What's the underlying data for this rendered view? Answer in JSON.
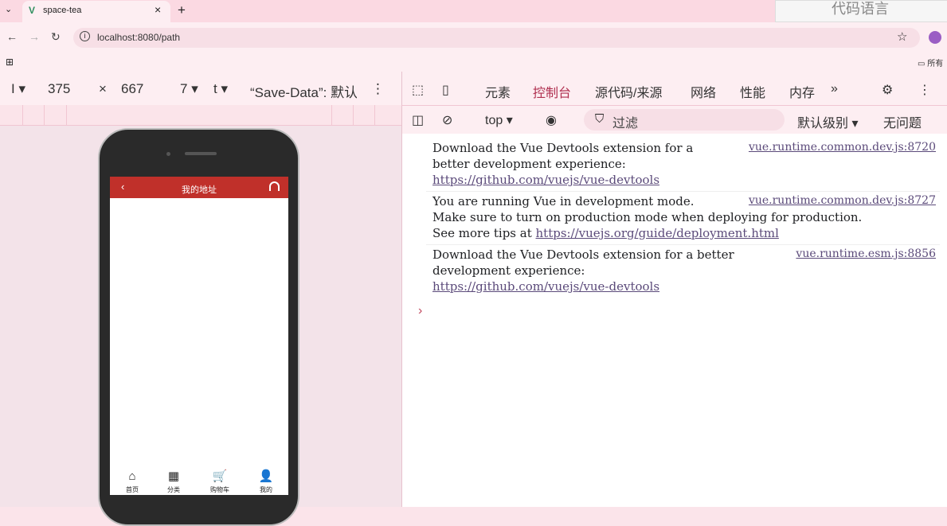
{
  "browser": {
    "tab_title": "space-tea",
    "url": "localhost:8080/path",
    "ime_text": "代码语言",
    "bookmarks_all": "所有"
  },
  "device_toolbar": {
    "device_truncated": "I",
    "width": "375",
    "height": "667",
    "zoom_truncated": "7",
    "throttle_truncated": "t",
    "save_data": "“Save-Data”: 默认"
  },
  "app": {
    "title": "我的地址",
    "tabbar": [
      {
        "icon": "⌂",
        "label": "首页"
      },
      {
        "icon": "▦",
        "label": "分类"
      },
      {
        "icon": "🛒",
        "label": "购物车"
      },
      {
        "icon": "👤",
        "label": "我的"
      }
    ]
  },
  "devtools": {
    "tabs": [
      "元素",
      "控制台",
      "源代码/来源",
      "网络",
      "性能",
      "内存"
    ],
    "context": "top",
    "filter_placeholder": "过滤",
    "level": "默认级别",
    "issues": "无问题",
    "messages": [
      {
        "lines": [
          "Download the Vue Devtools extension for a",
          "better development experience:"
        ],
        "link": "https://github.com/vuejs/vue-devtools",
        "source": "vue.runtime.common.dev.js:8720"
      },
      {
        "lines": [
          "You are running Vue in development mode.",
          "Make sure to turn on production mode when deploying for production."
        ],
        "tip_prefix": "See more tips at ",
        "link": "https://vuejs.org/guide/deployment.html",
        "source": "vue.runtime.common.dev.js:8727"
      },
      {
        "lines": [
          "Download the Vue Devtools extension for a better",
          "development experience:"
        ],
        "link": "https://github.com/vuejs/vue-devtools",
        "source": "vue.runtime.esm.js:8856"
      }
    ]
  }
}
